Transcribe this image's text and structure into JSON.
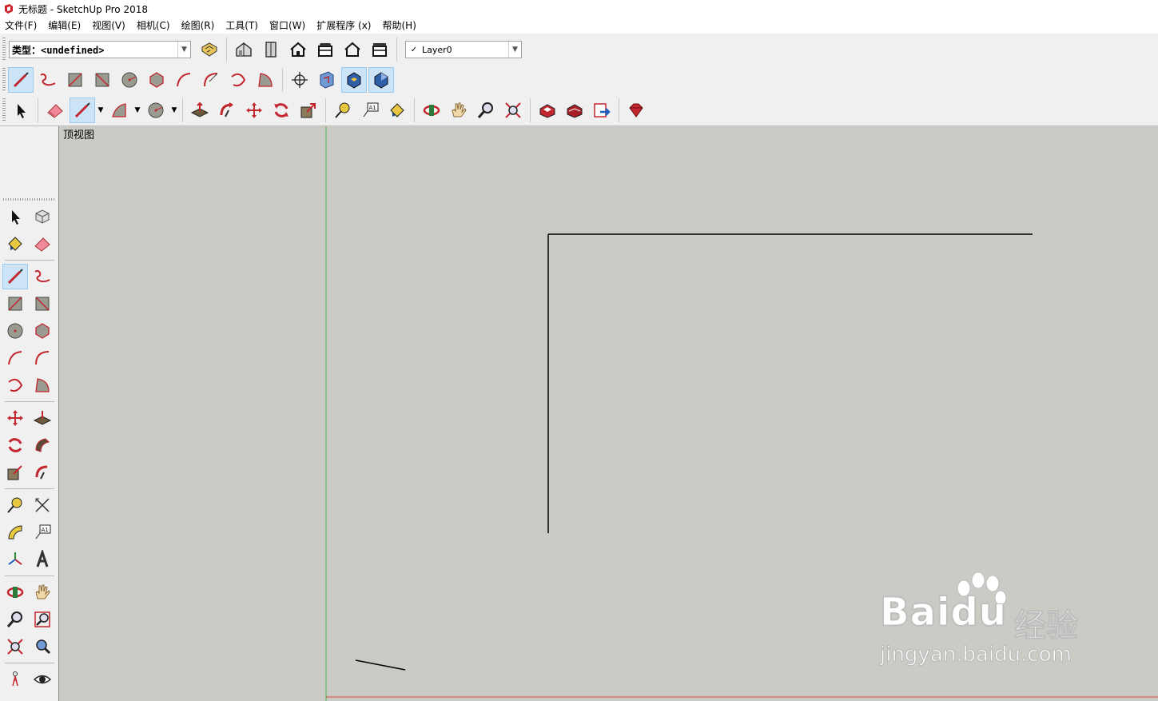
{
  "window": {
    "title": "无标题 - SketchUp Pro 2018"
  },
  "menu": [
    "文件(F)",
    "编辑(E)",
    "视图(V)",
    "相机(C)",
    "绘图(R)",
    "工具(T)",
    "窗口(W)",
    "扩展程序 (x)",
    "帮助(H)"
  ],
  "toolbar": {
    "type_combo": "类型：<undefined>",
    "layer_combo": {
      "checked": "✓",
      "value": "Layer0"
    }
  },
  "viewport": {
    "view_name": "顶视图"
  },
  "watermark": {
    "brand": "Bai",
    "brand2": "du",
    "cn": "经验",
    "url": "jingyan.baidu.com"
  },
  "icons": {
    "row1": [
      "component-attributes-icon",
      "iso-view-icon",
      "top-view-icon",
      "front-view-icon",
      "right-view-icon",
      "back-view-icon",
      "left-view-icon"
    ],
    "row2": [
      "line-tool-icon",
      "freehand-tool-icon",
      "rectangle-tool-icon",
      "rotated-rectangle-icon",
      "circle-tool-icon",
      "polygon-tool-icon",
      "arc-tool-icon",
      "two-point-arc-icon",
      "three-point-arc-icon",
      "pie-tool-icon",
      "axes-icon",
      "section-plane-icon",
      "section-fill-icon",
      "section-cut-icon"
    ],
    "row3": [
      "select-icon",
      "eraser-icon",
      "pencil-icon",
      "shapes-icon",
      "circle-icon",
      "push-pull-icon",
      "follow-me-icon",
      "move-icon",
      "rotate-icon",
      "scale-icon",
      "tape-measure-icon",
      "text-icon",
      "paint-bucket-icon",
      "orbit-icon",
      "pan-icon",
      "zoom-icon",
      "zoom-extents-icon",
      "warehouse-icon",
      "extension-warehouse-icon",
      "send-to-layout-icon",
      "ruby-console-icon"
    ]
  },
  "colors": {
    "accent_red": "#d0202a",
    "viewport_bg": "#cbcbc6",
    "green_axis": "#4bb34b",
    "red_axis": "#e04040"
  }
}
